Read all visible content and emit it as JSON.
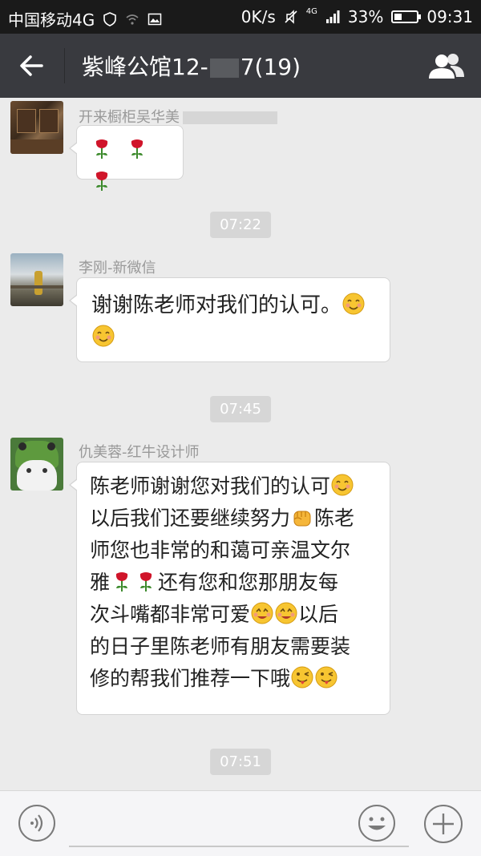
{
  "status_bar": {
    "carrier": "中国移动4G",
    "speed": "0K/s",
    "network": "4G",
    "battery": "33%",
    "time": "09:31"
  },
  "header": {
    "title": "紫峰公馆12-",
    "title_suffix": "7(19)"
  },
  "messages": [
    {
      "sender": "开来橱柜吴华美",
      "text": "",
      "emojis": [
        "rose",
        "rose",
        "rose"
      ]
    },
    {
      "timestamp": "07:22"
    },
    {
      "sender": "李刚-新微信",
      "text_line1": "谢谢陈老师对我们的认可。",
      "emojis": [
        "smile",
        "smile"
      ]
    },
    {
      "timestamp": "07:45"
    },
    {
      "sender": "仇美蓉-红牛设计师",
      "lines": [
        "陈老师谢谢您对我们的认可",
        "以后我们还要继续努力",
        "陈老",
        "师您也非常的和蔼可亲温文尔",
        "雅",
        "还有您和您那朋友每",
        "次斗嘴都非常可爱",
        "以后",
        "的日子里陈老师有朋友需要装",
        "修的帮我们推荐一下哦"
      ],
      "emojis": [
        "smile",
        "fist",
        "rose",
        "rose",
        "yum",
        "yum",
        "tongue",
        "tongue"
      ]
    },
    {
      "timestamp": "07:51"
    }
  ],
  "input": {
    "placeholder": ""
  },
  "colors": {
    "header_bg": "#393a3f",
    "chat_bg": "#ebebeb",
    "bubble_bg": "#ffffff",
    "timestamp_bg": "#d6d6d6"
  }
}
